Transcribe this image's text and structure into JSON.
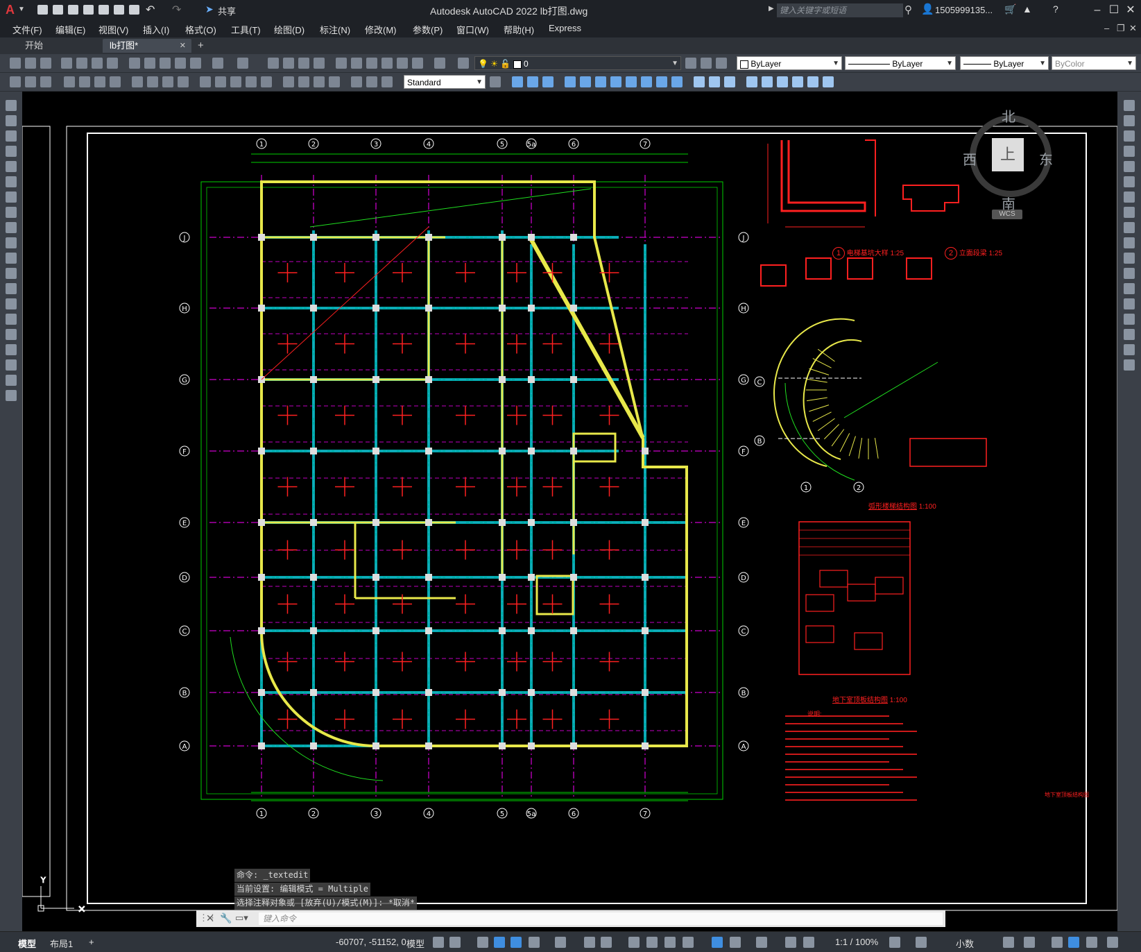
{
  "title_bar": {
    "app_title": "Autodesk AutoCAD 2022    lb打图.dwg",
    "share_label": "共享",
    "search_placeholder": "键入关键字或短语",
    "user_name": "1505999135...",
    "app_letter": "A"
  },
  "menu": {
    "items": [
      "文件(F)",
      "编辑(E)",
      "视图(V)",
      "插入(I)",
      "格式(O)",
      "工具(T)",
      "绘图(D)",
      "标注(N)",
      "修改(M)",
      "参数(P)",
      "窗口(W)",
      "帮助(H)",
      "Express"
    ]
  },
  "tabs": {
    "items": [
      {
        "label": "开始"
      },
      {
        "label": "lb打图*",
        "close": "✕"
      }
    ],
    "add": "+"
  },
  "toolbars": {
    "layer_value": "0",
    "color_value": "ByLayer",
    "linetype_value": "ByLayer",
    "lineweight_value": "ByLayer",
    "plotstyle_value": "ByColor",
    "text_style_value": "Standard"
  },
  "viewcube": {
    "north": "北",
    "south": "南",
    "east": "东",
    "west": "西",
    "top": "上",
    "wcs": "WCS"
  },
  "drawing": {
    "grid_x_labels": [
      "1",
      "2",
      "3",
      "4",
      "5",
      "5a",
      "6",
      "7"
    ],
    "grid_y_labels": [
      "J",
      "H",
      "G",
      "F",
      "E",
      "D",
      "C",
      "B",
      "A"
    ],
    "detail1_title": "电梯基坑大样",
    "detail1_num": "1",
    "detail1_scale": "1:25",
    "detail2_title": "立面段梁",
    "detail2_num": "2",
    "detail2_scale": "1:25",
    "arc_stair_title": "弧形楼梯结构图",
    "arc_stair_scale": "1:100",
    "arc_stair_axes_c": "C",
    "arc_stair_axes_b": "B",
    "arc_stair_axes_1": "1",
    "arc_stair_axes_2": "2",
    "roof_title": "地下室顶板结构图",
    "roof_scale": "1:100",
    "notes_title": "说明:",
    "stamp_text": "地下室顶板结构图"
  },
  "command": {
    "history": [
      "命令: _textedit",
      "当前设置: 编辑模式 = Multiple",
      "选择注释对象或 [放弃(U)/模式(M)]: *取消*"
    ],
    "input_placeholder": "键入命令"
  },
  "status": {
    "model_tab": "模型",
    "layout_tab": "布局1",
    "add_tab": "+",
    "coords": "-60707, -51152, 0",
    "model_label": "模型",
    "scale": "1:1 / 100%",
    "units": "小数"
  },
  "colors": {
    "canvas_bg": "#000000",
    "axis": "#ff00ff",
    "beam_cyan": "#00c8c8",
    "wall_yellow": "#e8e84a",
    "dim_green": "#00d000",
    "detail_red": "#ff2020",
    "frame_white": "#ffffff"
  }
}
